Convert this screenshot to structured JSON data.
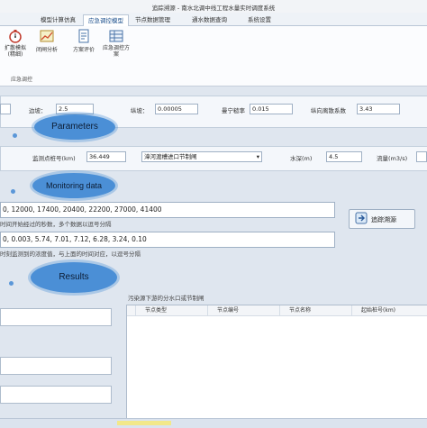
{
  "window": {
    "title": "追踪溯源 - 南水北调中线工程水量实时调度系统"
  },
  "menu_tabs": [
    {
      "label": "模型计算仿真"
    },
    {
      "label": "应急调控模型"
    },
    {
      "label": "节点数据管理"
    },
    {
      "label": "通水数据查询"
    },
    {
      "label": "系统设置"
    }
  ],
  "ribbon": {
    "buttons": [
      {
        "label": "扩散模拟(精细)",
        "icon": "stopwatch-icon"
      },
      {
        "label": "闭闸分析",
        "icon": "chart-icon"
      },
      {
        "label": "方案评价",
        "icon": "document-icon"
      },
      {
        "label": "应急调控方案",
        "icon": "grid-icon"
      }
    ],
    "group_label": "应急调控"
  },
  "params": {
    "slope_label": "边坡：",
    "slope_value": "2.5",
    "gradient_label": "纵坡：",
    "gradient_value": "0.00005",
    "roughness_label": "曼宁糙率",
    "roughness_value": "0.015",
    "dispersion_label": "纵向离散系数",
    "dispersion_value": "3.43"
  },
  "monitor": {
    "station_label": "监测点桩号(km)",
    "station_value": "36.449",
    "gate_value": "漳河渡槽进口节制闸",
    "depth_label": "水深(m)",
    "depth_value": "4.5",
    "flow_label": "流量(m3/s)"
  },
  "series": {
    "times": "0, 12000, 17400, 20400, 22200, 27000, 41400",
    "times_hint": "时间开始经过的秒数，多个数据以逗号分隔",
    "concentrations": "0, 0.003, 5.74, 7.01, 7.12, 6.28, 3.24, 0.10",
    "conc_hint": "时刻监测到的浓度值，与上面的时间对应，以逗号分隔"
  },
  "trace_button": {
    "label": "追踪溯源"
  },
  "results": {
    "table_title": "污染源下游的分水口或节制闸",
    "columns": [
      "节点类型",
      "节点编号",
      "节点名称",
      "起始桩号(km)"
    ]
  },
  "annotations": {
    "parameters": "Parameters",
    "monitoring": "Monitoring data",
    "results": "Results"
  },
  "colors": {
    "accent": "#4b8fd6",
    "panel": "#f4f7fb"
  }
}
